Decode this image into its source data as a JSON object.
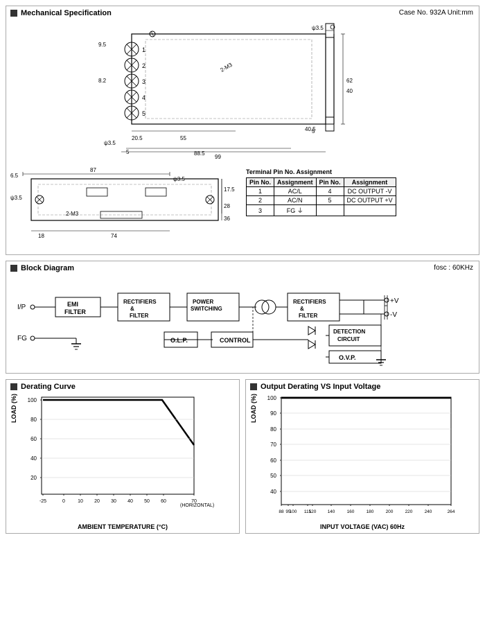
{
  "page": {
    "mech_title": "Mechanical Specification",
    "block_title": "Block Diagram",
    "derating_title": "Derating Curve",
    "output_derating_title": "Output Derating VS Input Voltage",
    "case_info": "Case No. 932A   Unit:mm",
    "fosc": "fosc : 60KHz",
    "terminal_table": {
      "title": "Terminal Pin No. Assignment",
      "headers": [
        "Pin No.",
        "Assignment",
        "Pin No.",
        "Assignment"
      ],
      "rows": [
        [
          "1",
          "AC/L",
          "4",
          "DC OUTPUT -V"
        ],
        [
          "2",
          "AC/N",
          "5",
          "DC OUTPUT +V"
        ],
        [
          "3",
          "FG ⏚",
          "",
          ""
        ]
      ]
    },
    "derating_x_label": "AMBIENT TEMPERATURE (°C)",
    "derating_y_label": "LOAD (%)",
    "output_x_label": "INPUT VOLTAGE (VAC) 60Hz",
    "output_y_label": "LOAD (%)",
    "derating_x_ticks": [
      "-25",
      "0",
      "10",
      "20",
      "30",
      "40",
      "50",
      "60",
      "70"
    ],
    "derating_x_right": "(HORIZONTAL)",
    "derating_y_ticks": [
      "100",
      "80",
      "60",
      "40",
      "20"
    ],
    "output_x_ticks": [
      "88",
      "95",
      "100",
      "115",
      "120",
      "140",
      "160",
      "180",
      "200",
      "220",
      "240",
      "264"
    ],
    "output_y_ticks": [
      "100",
      "90",
      "80",
      "70",
      "60",
      "50",
      "40"
    ]
  }
}
